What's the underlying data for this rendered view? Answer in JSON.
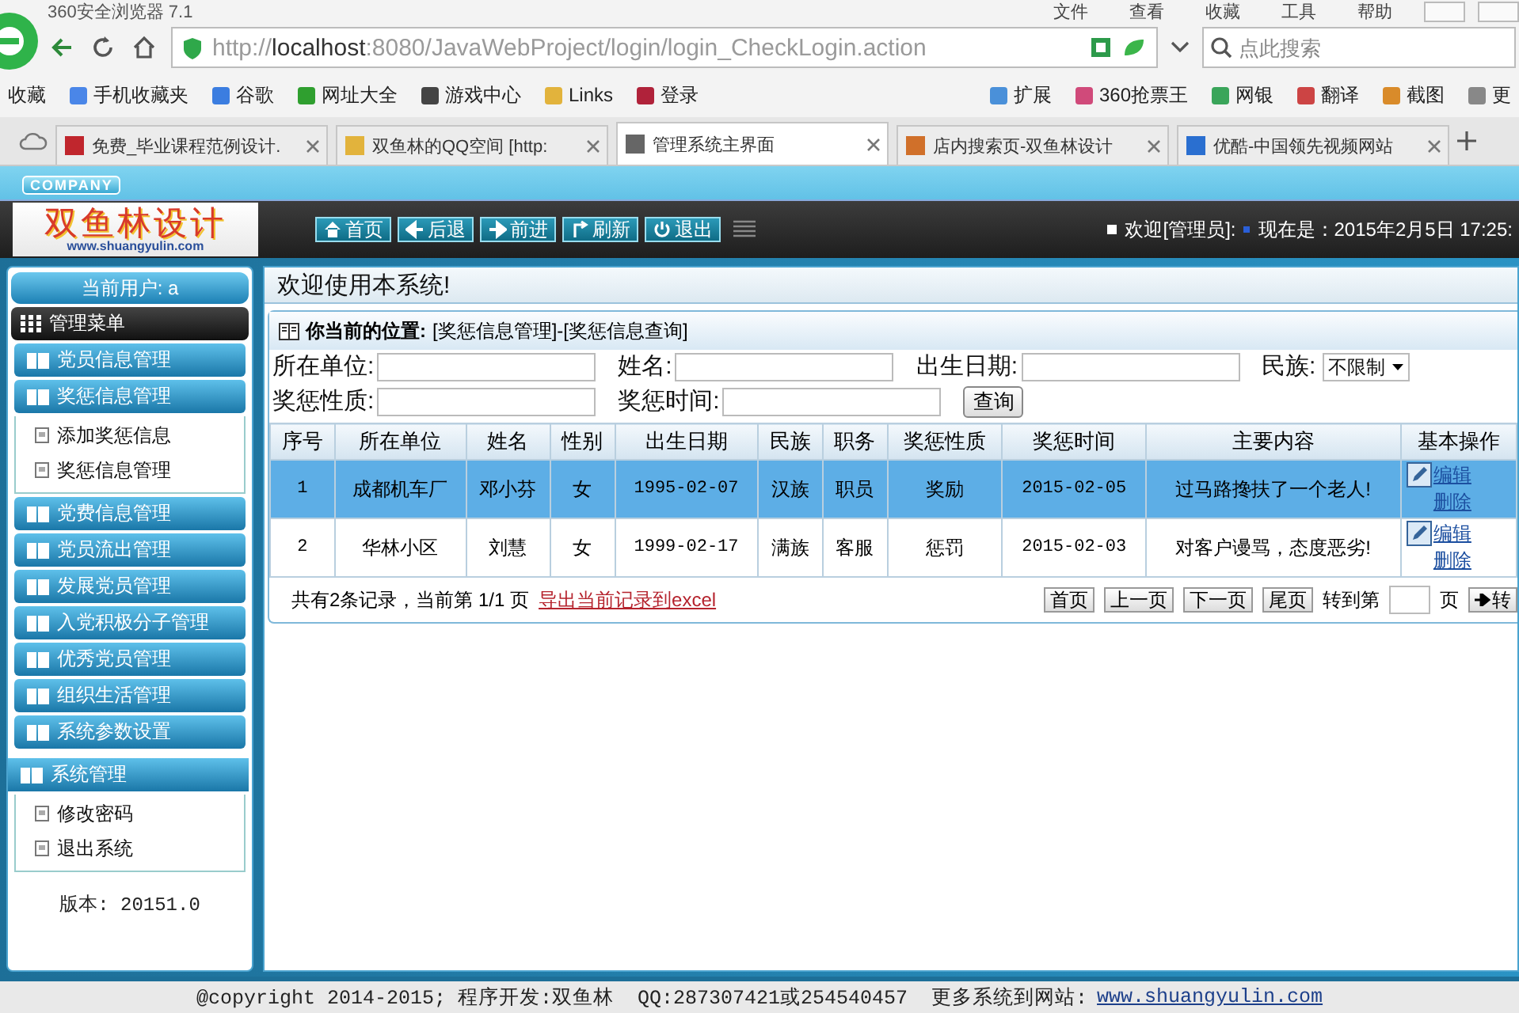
{
  "browser": {
    "title": "360安全浏览器 7.1",
    "menu": [
      "文件",
      "查看",
      "收藏",
      "工具",
      "帮助"
    ],
    "url": "http://**localhost**:8080/JavaWebProject/login/login_CheckLogin.action",
    "search": {
      "placeholder": "点此搜索"
    },
    "bookmarks": [
      "收藏",
      "手机收藏夹",
      "谷歌",
      "网址大全",
      "游戏中心",
      "Links",
      "登录"
    ],
    "bookmarks_right": [
      "扩展",
      "360抢票王",
      "网银",
      "翻译",
      "截图",
      "更"
    ],
    "tabs": [
      {
        "label": "免费_毕业课程范例设计.",
        "selected": false
      },
      {
        "label": "双鱼林的QQ空间 [http:",
        "selected": false
      },
      {
        "label": "管理系统主界面",
        "selected": true
      },
      {
        "label": "店内搜索页-双鱼林设计",
        "selected": false
      },
      {
        "label": "优酷-中国领先视频网站",
        "selected": false
      }
    ]
  },
  "header": {
    "company": "COMPANY",
    "logo": "双鱼林设计",
    "logo_url": "www.shuangyulin.com",
    "nav": [
      "首页",
      "后退",
      "前进",
      "刷新",
      "退出"
    ],
    "welcome": "欢迎[管理员]:",
    "time": "现在是：2015年2月5日 17:25:"
  },
  "sidebar": {
    "current_user": "当前用户: a",
    "menu_title": "管理菜单",
    "groups": [
      {
        "label": "党员信息管理"
      },
      {
        "label": "奖惩信息管理",
        "children": [
          "添加奖惩信息",
          "奖惩信息管理"
        ]
      },
      {
        "label": "党费信息管理"
      },
      {
        "label": "党员流出管理"
      },
      {
        "label": "发展党员管理"
      },
      {
        "label": "入党积极分子管理"
      },
      {
        "label": "优秀党员管理"
      },
      {
        "label": "组织生活管理"
      },
      {
        "label": "系统参数设置"
      }
    ],
    "system": {
      "label": "系统管理",
      "children": [
        "修改密码",
        "退出系统"
      ]
    },
    "version": "版本: 20151.0"
  },
  "main": {
    "welcome": "欢迎使用本系统!",
    "location_label": "你当前的位置:",
    "location": "[奖惩信息管理]-[奖惩信息查询]",
    "search_form": {
      "fields": [
        {
          "label": "所在单位:",
          "kind": "text"
        },
        {
          "label": "姓名:",
          "kind": "text"
        },
        {
          "label": "出生日期:",
          "kind": "text"
        },
        {
          "label": "民族:",
          "kind": "select",
          "value": "不限制"
        },
        {
          "label": "奖惩性质:",
          "kind": "text"
        },
        {
          "label": "奖惩时间:",
          "kind": "text"
        }
      ],
      "button": "查询"
    },
    "table": {
      "columns": [
        "序号",
        "所在单位",
        "姓名",
        "性别",
        "出生日期",
        "民族",
        "职务",
        "奖惩性质",
        "奖惩时间",
        "主要内容",
        "基本操作"
      ],
      "rows": [
        {
          "selected": true,
          "cells": [
            "1",
            "成都机车厂",
            "邓小芬",
            "女",
            "1995-02-07",
            "汉族",
            "职员",
            "奖励",
            "2015-02-05",
            "过马路搀扶了一个老人!"
          ],
          "actions": [
            "编辑",
            "删除"
          ]
        },
        {
          "selected": false,
          "cells": [
            "2",
            "华林小区",
            "刘慧",
            "女",
            "1999-02-17",
            "满族",
            "客服",
            "惩罚",
            "2015-02-03",
            "对客户谩骂，态度恶劣!"
          ],
          "actions": [
            "编辑",
            "删除"
          ]
        }
      ]
    },
    "pager": {
      "summary": "共有2条记录，当前第 1/1 页",
      "export": "导出当前记录到excel",
      "buttons": [
        "首页",
        "上一页",
        "下一页",
        "尾页"
      ],
      "goto_label": "转到第",
      "page_unit": "页",
      "go": "转"
    }
  },
  "footer": {
    "text": "@copyright 2014-2015; 程序开发:双鱼林  QQ:287307421或254540457  更多系统到网站:",
    "link": "www.shuangyulin.com"
  }
}
